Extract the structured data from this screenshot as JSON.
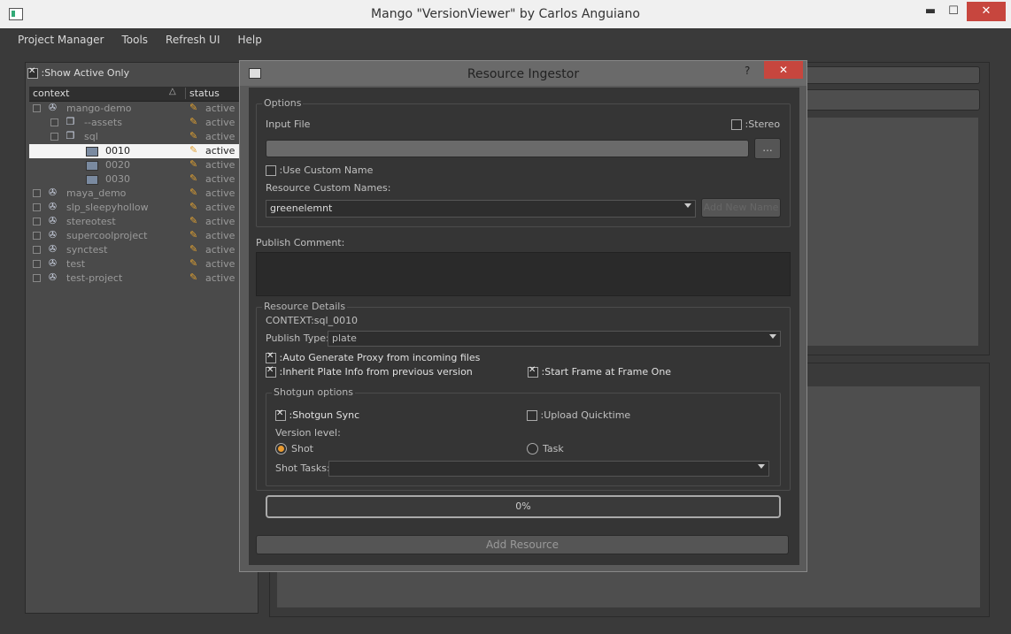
{
  "window": {
    "title": "Mango \"VersionViewer\" by Carlos Anguiano",
    "minimize": "▬",
    "maximize": "☐",
    "close": "✕"
  },
  "menu": [
    "Project Manager",
    "Tools",
    "Refresh UI",
    "Help"
  ],
  "left_panel": {
    "show_active_label": ":Show Active Only",
    "show_active_checked": true,
    "columns": [
      "context",
      "status"
    ],
    "rows": [
      {
        "label": "mango-demo",
        "status": "active",
        "level": 0,
        "icon": "reel-icon"
      },
      {
        "label": "--assets",
        "status": "active",
        "level": 1,
        "icon": "folder-icon"
      },
      {
        "label": "sql",
        "status": "active",
        "level": 1,
        "icon": "folder-icon"
      },
      {
        "label": "0010",
        "status": "active",
        "level": 2,
        "icon": "film-icon",
        "selected": true
      },
      {
        "label": "0020",
        "status": "active",
        "level": 2,
        "icon": "film-icon"
      },
      {
        "label": "0030",
        "status": "active",
        "level": 2,
        "icon": "film-icon"
      },
      {
        "label": "maya_demo",
        "status": "active",
        "level": 0,
        "icon": "reel-icon"
      },
      {
        "label": "slp_sleepyhollow",
        "status": "active",
        "level": 0,
        "icon": "reel-icon"
      },
      {
        "label": "stereotest",
        "status": "active",
        "level": 0,
        "icon": "reel-icon"
      },
      {
        "label": "supercoolproject",
        "status": "active",
        "level": 0,
        "icon": "reel-icon"
      },
      {
        "label": "synctest",
        "status": "active",
        "level": 0,
        "icon": "reel-icon"
      },
      {
        "label": "test",
        "status": "active",
        "level": 0,
        "icon": "reel-icon"
      },
      {
        "label": "test-project",
        "status": "active",
        "level": 0,
        "icon": "reel-icon"
      }
    ]
  },
  "dialog": {
    "title": "Resource Ingestor",
    "help": "?",
    "close": "✕",
    "options": {
      "group_title": "Options",
      "input_file_label": "Input File",
      "stereo_label": ":Stereo",
      "stereo_checked": false,
      "browse_label": "...",
      "use_custom_name_label": ":Use Custom Name",
      "use_custom_name_checked": false,
      "custom_names_label": "Resource Custom Names:",
      "custom_name_value": "greenelemnt",
      "add_new_name_label": "Add New Name"
    },
    "publish_comment_label": "Publish Comment:",
    "resource_details": {
      "group_title": "Resource Details",
      "context_label": "CONTEXT:sql_0010",
      "publish_type_label": "Publish Type:",
      "publish_type_value": "plate",
      "auto_proxy_label": ":Auto Generate Proxy from incoming files",
      "auto_proxy_checked": true,
      "inherit_plate_label": ":Inherit Plate Info from previous version",
      "inherit_plate_checked": true,
      "start_frame_label": ":Start Frame at Frame One",
      "start_frame_checked": true
    },
    "shotgun": {
      "group_title": "Shotgun options",
      "sync_label": ":Shotgun Sync",
      "sync_checked": true,
      "upload_quicktime_label": ":Upload Quicktime",
      "upload_quicktime_checked": false,
      "version_level_label": "Version level:",
      "shot_label": "Shot",
      "task_label": "Task",
      "selected_level": "Shot",
      "shot_tasks_label": "Shot Tasks:",
      "shot_tasks_value": ""
    },
    "progress": {
      "text": "0%",
      "value": 0
    },
    "add_resource_label": "Add Resource"
  }
}
